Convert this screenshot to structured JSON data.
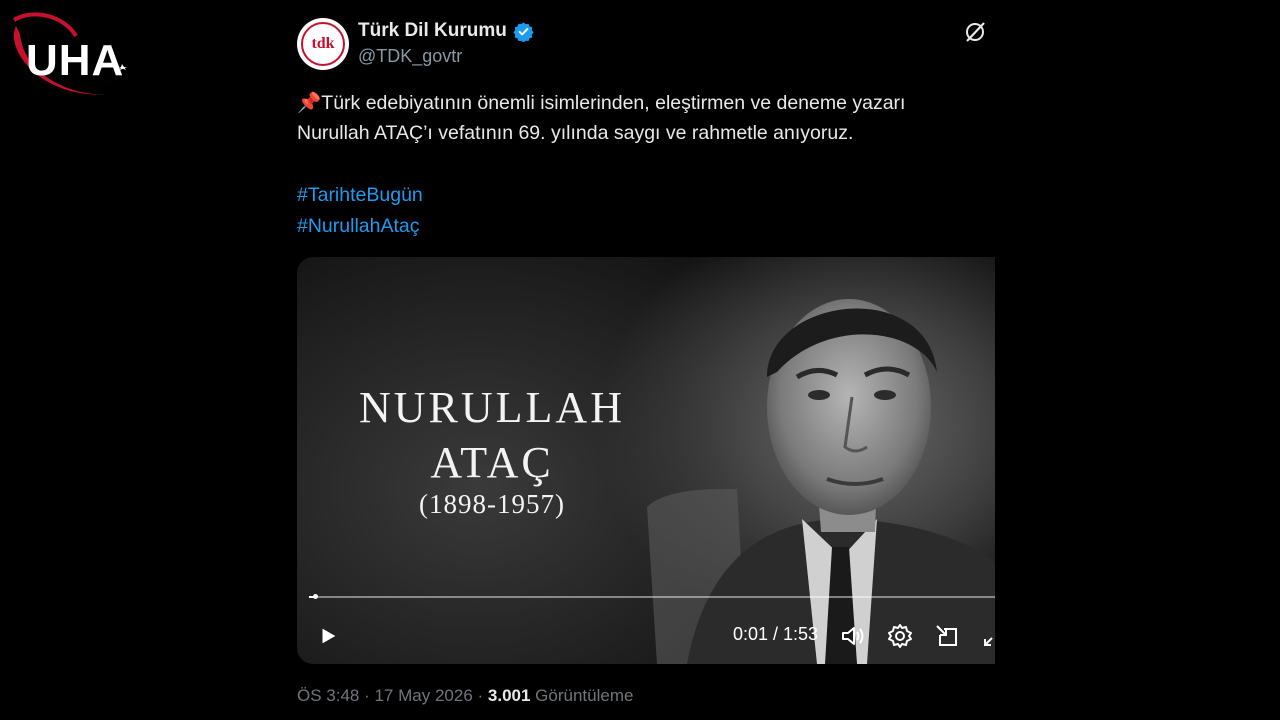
{
  "logo": {
    "text": "UHA"
  },
  "tweet": {
    "author_name": "Türk Dil Kurumu",
    "handle": "@TDK_govtr",
    "avatar_text": "tdk",
    "pin_emoji": "📌",
    "text_line1": "Türk edebiyatının önemli isimlerinden, eleştirmen ve deneme yazarı",
    "text_line2": "Nurullah ATAÇ’ı vefatının 69. yılında saygı ve rahmetle anıyoruz.",
    "hashtags": [
      "#TarihteBugün",
      "#NurullahAtaç"
    ],
    "timestamp": "ÖS 3:48 · 17 May 2026 ·",
    "views_count": "3.001",
    "views_label": "Görüntüleme"
  },
  "video": {
    "title_line1": "NURULLAH",
    "title_line2": "ATAÇ",
    "years": "(1898-1957)",
    "time_display": "0:01 / 1:53",
    "progress": 0.009
  },
  "colors": {
    "link": "#1d9bf0",
    "verified": "#1d9bf0",
    "brand_red": "#c8102e",
    "secondary_text": "#71767b"
  }
}
